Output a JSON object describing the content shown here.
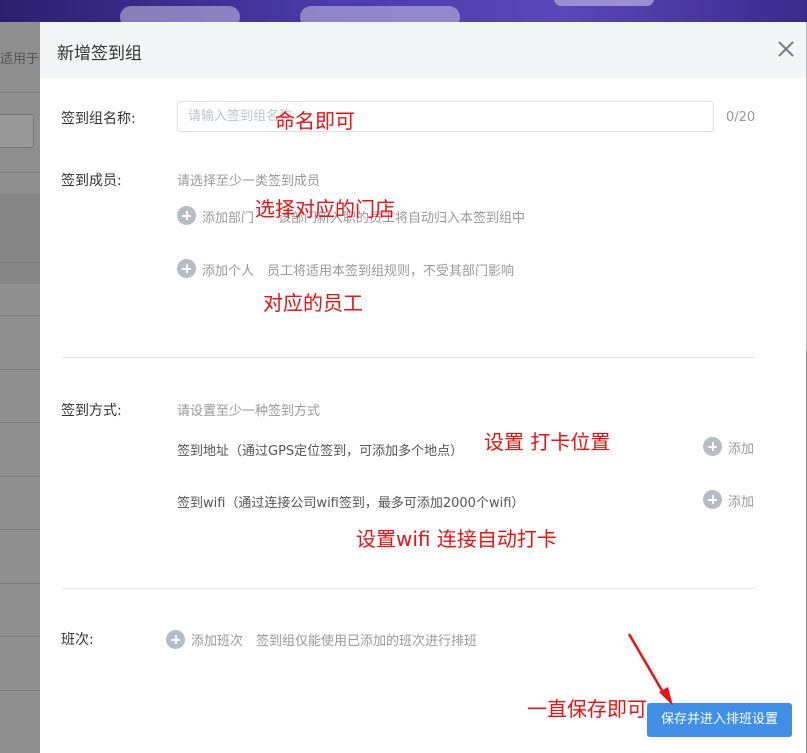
{
  "background": {
    "text": "适用于鲁"
  },
  "dialog": {
    "title": "新增签到组",
    "close_icon": "close-icon"
  },
  "form": {
    "group_name": {
      "label": "签到组名称:",
      "placeholder": "请输入签到组名称",
      "counter": "0/20"
    },
    "members": {
      "label": "签到成员:",
      "hint": "请选择至少一类签到成员",
      "add_department": {
        "label": "添加部门",
        "desc": "该部门新入职的员工将自动归入本签到组中"
      },
      "add_person": {
        "label": "添加个人",
        "desc": "员工将适用本签到组规则，不受其部门影响"
      }
    },
    "method": {
      "label": "签到方式:",
      "hint": "请设置至少一种签到方式",
      "address": {
        "text": "签到地址（通过GPS定位签到，可添加多个地点）",
        "add_label": "添加"
      },
      "wifi": {
        "text": "签到wifi（通过连接公司wifi签到，最多可添加2000个wifi）",
        "add_label": "添加"
      }
    },
    "shift": {
      "label": "班次:",
      "add_label": "添加班次",
      "desc": "签到组仅能使用已添加的班次进行排班"
    },
    "save_button": "保存并进入排班设置"
  },
  "annotations": {
    "name": "命名即可",
    "store": "选择对应的门店",
    "staff": "对应的员工",
    "location": "设置 打卡位置",
    "wifi": "设置wifi 连接自动打卡",
    "save": "一直保存即可"
  },
  "colors": {
    "annotation": "#ee1111",
    "primary_button": "#3f8fe8",
    "icon_gray": "#b6bcc6"
  }
}
